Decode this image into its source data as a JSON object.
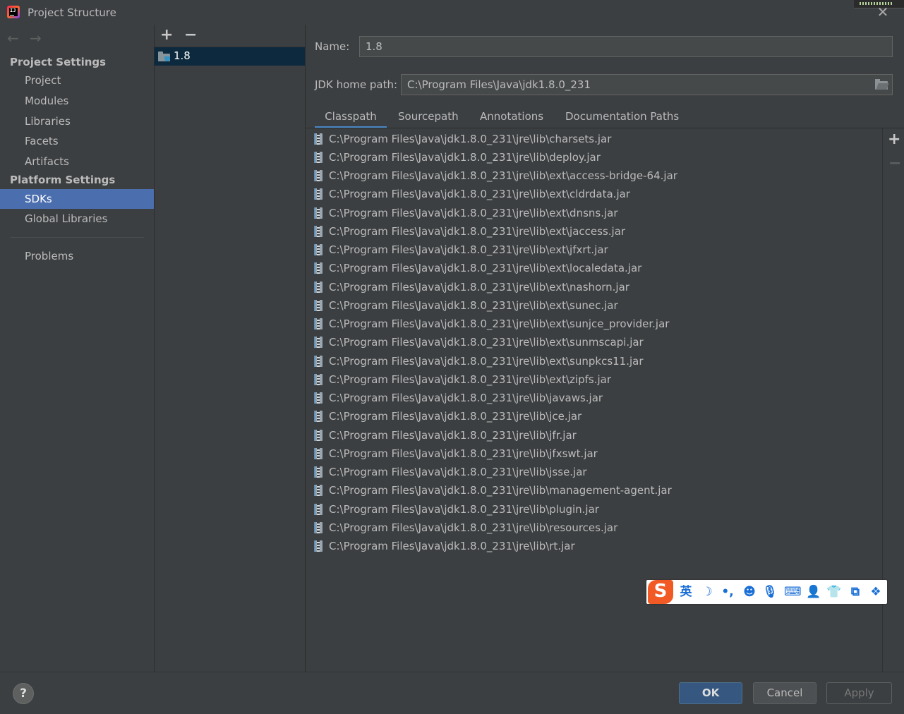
{
  "window": {
    "title": "Project Structure",
    "close_glyph": "✕"
  },
  "nav": {
    "back_glyph": "←",
    "forward_glyph": "→"
  },
  "sidebar": {
    "project_settings_header": "Project Settings",
    "project_settings_items": [
      "Project",
      "Modules",
      "Libraries",
      "Facets",
      "Artifacts"
    ],
    "platform_settings_header": "Platform Settings",
    "platform_settings_items": [
      "SDKs",
      "Global Libraries"
    ],
    "selected_item": "SDKs",
    "problems_label": "Problems"
  },
  "sdk_list": {
    "add_glyph": "+",
    "remove_glyph": "−",
    "items": [
      "1.8"
    ]
  },
  "sdk_detail": {
    "name_label": "Name:",
    "name_value": "1.8",
    "jdk_home_label": "JDK home path:",
    "jdk_home_value": "C:\\Program Files\\Java\\jdk1.8.0_231",
    "tabs": [
      "Classpath",
      "Sourcepath",
      "Annotations",
      "Documentation Paths"
    ],
    "active_tab": "Classpath",
    "classpath_add_glyph": "+",
    "classpath_remove_glyph": "−",
    "classpath": [
      "C:\\Program Files\\Java\\jdk1.8.0_231\\jre\\lib\\charsets.jar",
      "C:\\Program Files\\Java\\jdk1.8.0_231\\jre\\lib\\deploy.jar",
      "C:\\Program Files\\Java\\jdk1.8.0_231\\jre\\lib\\ext\\access-bridge-64.jar",
      "C:\\Program Files\\Java\\jdk1.8.0_231\\jre\\lib\\ext\\cldrdata.jar",
      "C:\\Program Files\\Java\\jdk1.8.0_231\\jre\\lib\\ext\\dnsns.jar",
      "C:\\Program Files\\Java\\jdk1.8.0_231\\jre\\lib\\ext\\jaccess.jar",
      "C:\\Program Files\\Java\\jdk1.8.0_231\\jre\\lib\\ext\\jfxrt.jar",
      "C:\\Program Files\\Java\\jdk1.8.0_231\\jre\\lib\\ext\\localedata.jar",
      "C:\\Program Files\\Java\\jdk1.8.0_231\\jre\\lib\\ext\\nashorn.jar",
      "C:\\Program Files\\Java\\jdk1.8.0_231\\jre\\lib\\ext\\sunec.jar",
      "C:\\Program Files\\Java\\jdk1.8.0_231\\jre\\lib\\ext\\sunjce_provider.jar",
      "C:\\Program Files\\Java\\jdk1.8.0_231\\jre\\lib\\ext\\sunmscapi.jar",
      "C:\\Program Files\\Java\\jdk1.8.0_231\\jre\\lib\\ext\\sunpkcs11.jar",
      "C:\\Program Files\\Java\\jdk1.8.0_231\\jre\\lib\\ext\\zipfs.jar",
      "C:\\Program Files\\Java\\jdk1.8.0_231\\jre\\lib\\javaws.jar",
      "C:\\Program Files\\Java\\jdk1.8.0_231\\jre\\lib\\jce.jar",
      "C:\\Program Files\\Java\\jdk1.8.0_231\\jre\\lib\\jfr.jar",
      "C:\\Program Files\\Java\\jdk1.8.0_231\\jre\\lib\\jfxswt.jar",
      "C:\\Program Files\\Java\\jdk1.8.0_231\\jre\\lib\\jsse.jar",
      "C:\\Program Files\\Java\\jdk1.8.0_231\\jre\\lib\\management-agent.jar",
      "C:\\Program Files\\Java\\jdk1.8.0_231\\jre\\lib\\plugin.jar",
      "C:\\Program Files\\Java\\jdk1.8.0_231\\jre\\lib\\resources.jar",
      "C:\\Program Files\\Java\\jdk1.8.0_231\\jre\\lib\\rt.jar"
    ]
  },
  "ime_toolbar": {
    "logo": "S",
    "items": [
      {
        "icon": "lang-english-icon",
        "glyph": "英"
      },
      {
        "icon": "moon-icon",
        "glyph": "☽"
      },
      {
        "icon": "punctuation-icon",
        "glyph": "•,"
      },
      {
        "icon": "emoji-icon",
        "glyph": "☻"
      },
      {
        "icon": "microphone-icon",
        "glyph": "🎙"
      },
      {
        "icon": "keyboard-icon",
        "glyph": "⌨"
      },
      {
        "icon": "user-icon",
        "glyph": "👤"
      },
      {
        "icon": "skin-shirt-icon",
        "glyph": "👕"
      },
      {
        "icon": "toolbox-icon",
        "glyph": "⧉"
      },
      {
        "icon": "apps-grid-icon",
        "glyph": "❖"
      }
    ]
  },
  "footer": {
    "help_glyph": "?",
    "ok_label": "OK",
    "cancel_label": "Cancel",
    "apply_label": "Apply"
  },
  "colors": {
    "background": "#3c3f41",
    "selection": "#4b6eaf",
    "list_selection": "#0d293e",
    "tab_underline": "#4a88c7",
    "ok_button": "#365880"
  }
}
